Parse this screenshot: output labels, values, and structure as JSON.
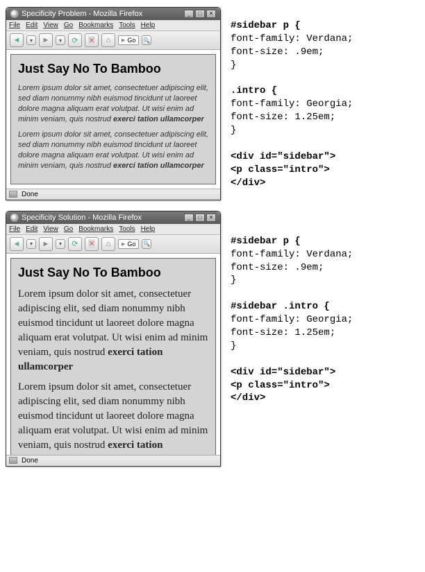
{
  "window1": {
    "title": "Specificity Problem - Mozilla Firefox",
    "status": "Done"
  },
  "window2": {
    "title": "Specificity Solution - Mozilla Firefox",
    "status": "Done"
  },
  "menus": {
    "file": "File",
    "edit": "Edit",
    "view": "View",
    "go": "Go",
    "bookmarks": "Bookmarks",
    "tools": "Tools",
    "help": "Help"
  },
  "toolbar": {
    "go": "Go"
  },
  "content": {
    "heading": "Just Say No To Bamboo",
    "para_plain": "Lorem ipsum dolor sit amet, consectetuer adipiscing elit, sed diam nonummy nibh euismod tincidunt ut laoreet dolore magna aliquam erat volutpat. Ut wisi enim ad minim veniam, quis nostrud ",
    "para_bold": "exerci tation ullamcorper",
    "para2_plain": "Lorem ipsum dolor sit amet, consectetuer adipiscing elit, sed diam nonummy nibh euismod tincidunt ut laoreet dolore magna aliquam erat volutpat. Ut wisi enim ad minim veniam, quis nostrud ",
    "para2_bold": "exerci tation ullamcorper"
  },
  "code1": {
    "l1": "#sidebar p {",
    "l2": "font-family: Verdana;",
    "l3": "font-size: .9em;",
    "l4": "}",
    "l5": "",
    "l6": ".intro {",
    "l7": "font-family: Georgia;",
    "l8": "font-size: 1.25em;",
    "l9": "}",
    "l10": "",
    "l11": "<div id=\"sidebar\">",
    "l12": "<p class=\"intro\">",
    "l13": "</div>"
  },
  "code2": {
    "l1": "#sidebar p {",
    "l2": "font-family: Verdana;",
    "l3": "font-size: .9em;",
    "l4": "}",
    "l5": "",
    "l6": "#sidebar .intro {",
    "l7": "font-family: Georgia;",
    "l8": "font-size: 1.25em;",
    "l9": "}",
    "l10": "",
    "l11": "<div id=\"sidebar\">",
    "l12": "<p class=\"intro\">",
    "l13": "</div>"
  }
}
